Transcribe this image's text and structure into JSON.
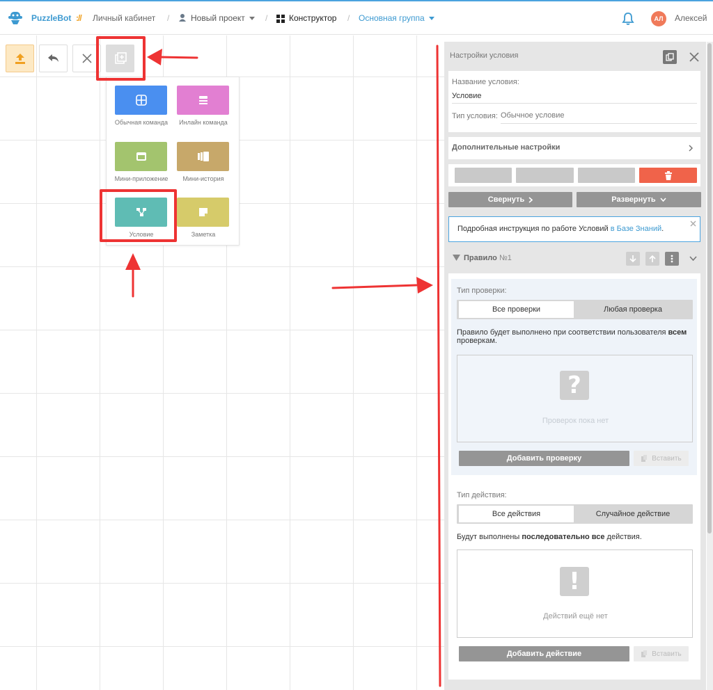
{
  "header": {
    "brand": "PuzzleBot",
    "brand_slash": "://",
    "crumb_cabinet": "Личный кабинет",
    "crumb_project": "Новый проект",
    "crumb_builder": "Конструктор",
    "crumb_group": "Основная группа",
    "avatar_initials": "АЛ",
    "user_name": "Алексей"
  },
  "palette": {
    "items": [
      {
        "label": "Обычная команда",
        "color": "#4a8ff0",
        "icon": "grid-icon"
      },
      {
        "label": "Инлайн команда",
        "color": "#e27fd2",
        "icon": "list-icon"
      },
      {
        "label": "Мини-приложение",
        "color": "#a3c46e",
        "icon": "window-icon"
      },
      {
        "label": "Мини-история",
        "color": "#c7a86a",
        "icon": "stories-icon"
      },
      {
        "label": "Условие",
        "color": "#5fbcb4",
        "icon": "branch-icon"
      },
      {
        "label": "Заметка",
        "color": "#d6cb6a",
        "icon": "note-icon"
      }
    ]
  },
  "panel": {
    "title": "Настройки условия",
    "name_label": "Название условия:",
    "name_value": "Условие",
    "type_label": "Тип условия:",
    "type_value": "Обычное условие",
    "extra_settings": "Дополнительные настройки",
    "collapse": "Свернуть",
    "expand": "Развернуть",
    "info_text": "Подробная инструкция по работе Условий ",
    "info_link": "в Базе Знаний",
    "info_dot": ".",
    "rule_label": "Правило",
    "rule_number": "№1",
    "check_type_label": "Тип проверки:",
    "check_all": "Все проверки",
    "check_any": "Любая проверка",
    "check_desc_1": "Правило будет выполнено при соответствии пользователя ",
    "check_desc_bold": "всем",
    "check_desc_2": "проверкам.",
    "no_checks": "Проверок пока нет",
    "add_check": "Добавить проверку",
    "paste": "Вставить",
    "action_type_label": "Тип действия:",
    "action_all": "Все действия",
    "action_random": "Случайное действие",
    "action_desc_1": "Будут выполнены ",
    "action_desc_bold": "последовательно все",
    "action_desc_2": " действия.",
    "no_actions": "Действий ещё нет",
    "add_action": "Добавить действие"
  },
  "colors": {
    "accent": "#3d9ad1",
    "brand_slash": "#f0a020",
    "danger": "#f0634a",
    "annotation_red": "#ee3333"
  }
}
